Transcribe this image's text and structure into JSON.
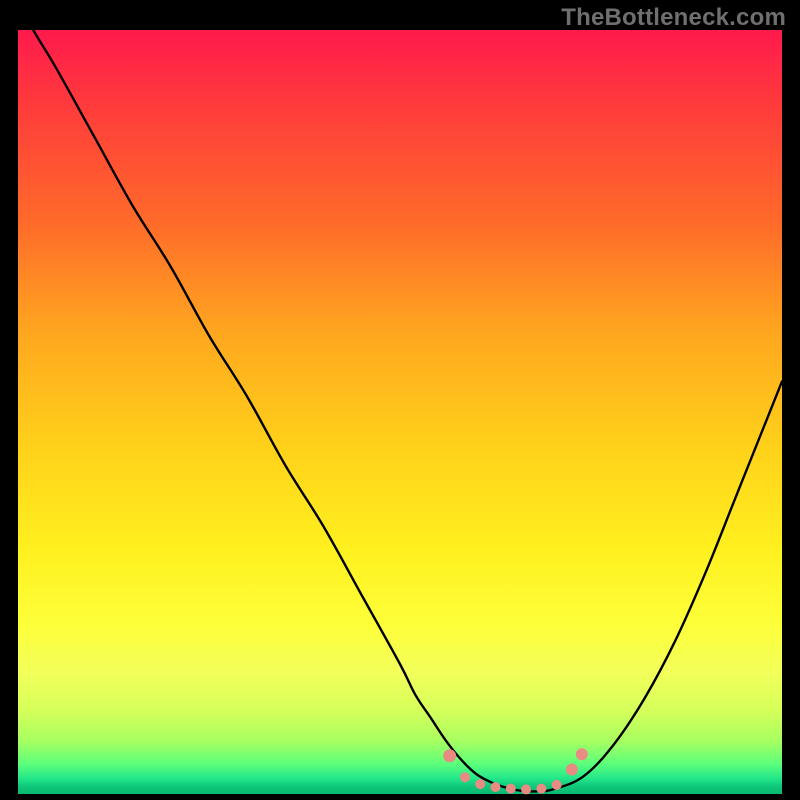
{
  "watermark": "TheBottleneck.com",
  "chart_data": {
    "type": "line",
    "title": "",
    "xlabel": "",
    "ylabel": "",
    "xlim": [
      0,
      100
    ],
    "ylim": [
      0,
      100
    ],
    "series": [
      {
        "name": "curve",
        "color": "#000000",
        "x": [
          0,
          2,
          5,
          10,
          15,
          20,
          25,
          30,
          35,
          40,
          45,
          50,
          52,
          54,
          56,
          58,
          60,
          62,
          64,
          66,
          68,
          70,
          74,
          78,
          82,
          86,
          90,
          94,
          98,
          100
        ],
        "y": [
          104,
          100,
          95,
          86,
          77,
          69,
          60,
          52,
          43,
          35,
          26,
          17,
          13,
          10,
          7,
          4.5,
          2.6,
          1.5,
          0.8,
          0.4,
          0.35,
          0.6,
          2.3,
          6.5,
          12.5,
          20,
          29,
          39,
          49,
          54
        ]
      }
    ],
    "markers": [
      {
        "name": "left-dot",
        "x": 56.5,
        "y": 5.0,
        "r": 6.5,
        "color": "#e88b82"
      },
      {
        "name": "basin-dot-1",
        "x": 58.5,
        "y": 2.2,
        "r": 5.0,
        "color": "#e88b82"
      },
      {
        "name": "basin-dot-2",
        "x": 60.5,
        "y": 1.3,
        "r": 5.0,
        "color": "#e88b82"
      },
      {
        "name": "basin-dot-3",
        "x": 62.5,
        "y": 0.9,
        "r": 5.0,
        "color": "#e88b82"
      },
      {
        "name": "basin-dot-4",
        "x": 64.5,
        "y": 0.7,
        "r": 5.0,
        "color": "#e88b82"
      },
      {
        "name": "basin-dot-5",
        "x": 66.5,
        "y": 0.6,
        "r": 5.0,
        "color": "#e88b82"
      },
      {
        "name": "basin-dot-6",
        "x": 68.5,
        "y": 0.7,
        "r": 5.0,
        "color": "#e88b82"
      },
      {
        "name": "basin-dot-7",
        "x": 70.5,
        "y": 1.2,
        "r": 5.0,
        "color": "#e88b82"
      },
      {
        "name": "right-dot-1",
        "x": 72.5,
        "y": 3.2,
        "r": 6.0,
        "color": "#e88b82"
      },
      {
        "name": "right-dot-2",
        "x": 73.8,
        "y": 5.2,
        "r": 6.0,
        "color": "#e88b82"
      }
    ]
  }
}
